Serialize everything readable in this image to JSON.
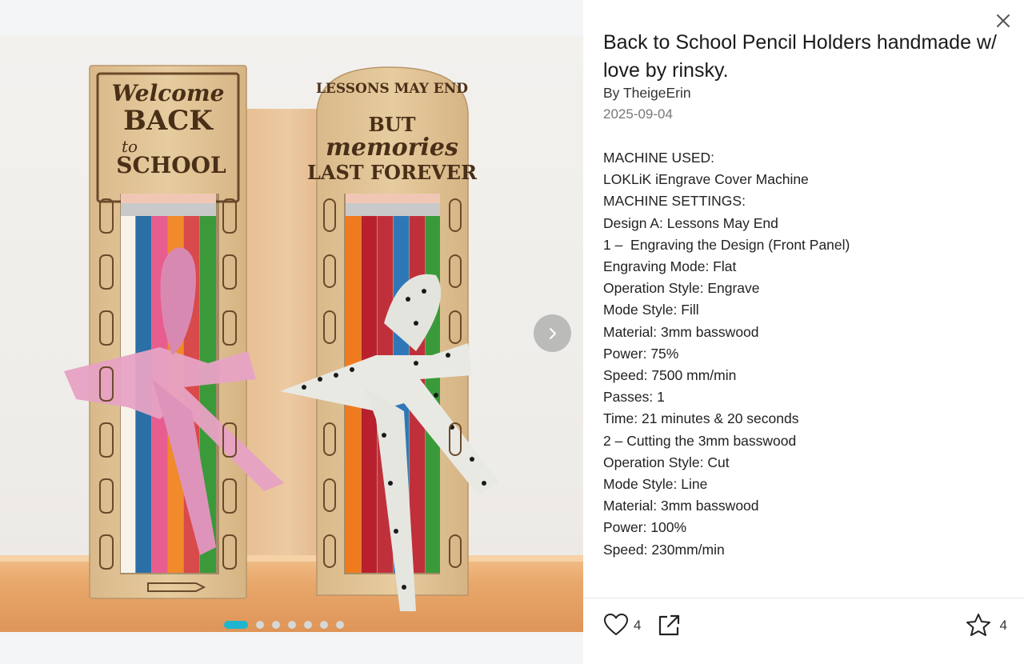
{
  "gallery": {
    "slides": 7,
    "active_slide": 1,
    "next_icon": "chevron-right-icon",
    "accent": "#1fb5d1"
  },
  "photo": {
    "left_plaque": [
      "Welcome",
      "BACK",
      "to",
      "SCHOOL"
    ],
    "right_plaque": [
      "LESSONS MAY END",
      "BUT",
      "memories",
      "LAST FOREVER"
    ]
  },
  "post": {
    "title": "Back to School Pencil Holders handmade w/ love by rinsky.",
    "author": "By TheigeErin",
    "date": "2025-09-04",
    "description": [
      "MACHINE USED:",
      "LOKLiK iEngrave Cover Machine",
      "MACHINE SETTINGS:",
      "Design A: Lessons May End",
      "1 –  Engraving the Design (Front Panel)",
      "Engraving Mode: Flat",
      "Operation Style: Engrave",
      "Mode Style: Fill",
      "Material: 3mm basswood",
      "Power: 75%",
      "Speed: 7500 mm/min",
      "Passes: 1",
      "Time: 21 minutes & 20 seconds",
      "2 – Cutting the 3mm basswood",
      "Operation Style: Cut",
      "Mode Style: Line",
      "Material: 3mm basswood",
      "Power: 100%",
      "Speed: 230mm/min"
    ]
  },
  "actions": {
    "likes": "4",
    "favorites": "4",
    "like_icon": "heart-icon",
    "share_icon": "share-icon",
    "favorite_icon": "star-icon",
    "close_icon": "close-icon"
  }
}
